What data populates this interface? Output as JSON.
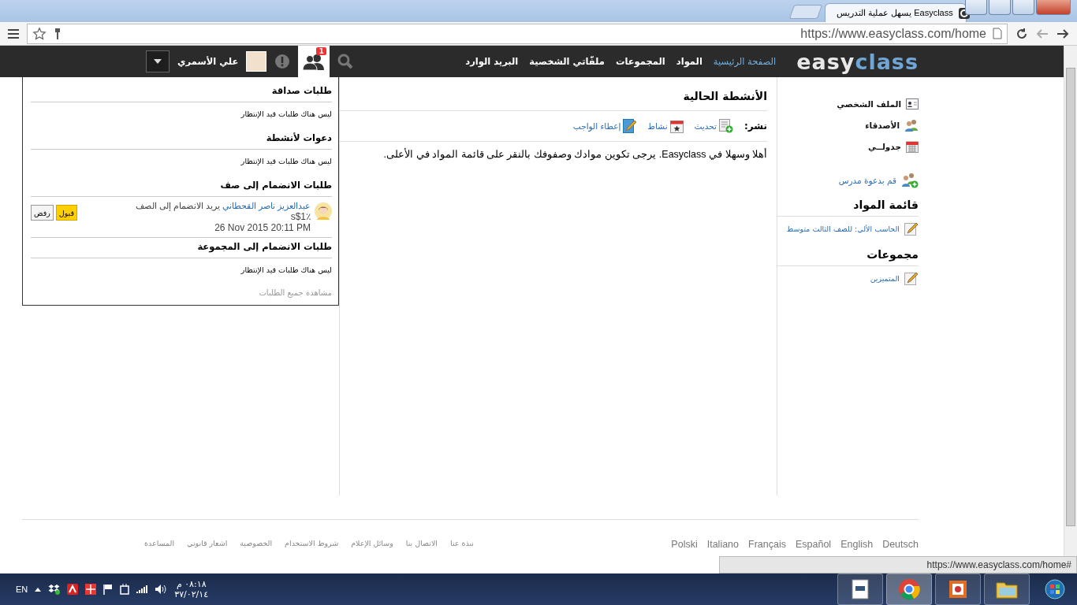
{
  "browser": {
    "tab_title": "يسهل عملية التدريس Easyclass",
    "url": "https://www.easyclass.com/home",
    "status_url": "https://www.easyclass.com/home#"
  },
  "navbar": {
    "logo": {
      "light_part": "easy",
      "blue_part": "class"
    },
    "items": [
      {
        "label": "الصفحة الرئيسية",
        "selected": true
      },
      {
        "label": "المواد",
        "selected": false
      },
      {
        "label": "المجموعات",
        "selected": false
      },
      {
        "label": "ملفّاتي الشخصية",
        "selected": false
      },
      {
        "label": "البريد الوارد",
        "selected": false
      }
    ],
    "friends_badge": "1",
    "user_name": "علي الأسمري"
  },
  "sidebar": {
    "links": [
      {
        "kind": "profile",
        "label": "الملف الشخصي"
      },
      {
        "kind": "friends",
        "label": "الأصدقاء"
      },
      {
        "kind": "calendar",
        "label": "جدولــي"
      }
    ],
    "invite": "قم بدعوة مدرس",
    "courses_title": "قائمة المواد",
    "courses": [
      "الحاسب الألي: للصف الثالث متوسط"
    ],
    "groups_title": "مجموعات",
    "groups": [
      "المتميزين"
    ]
  },
  "activity": {
    "title": "الأنشطة الحالية",
    "post_label": "نشر:",
    "post_actions": [
      {
        "kind": "update",
        "label": "تحديث"
      },
      {
        "kind": "event",
        "label": "نشاط"
      },
      {
        "kind": "assignment",
        "label": "إعطاء الواجب"
      }
    ],
    "welcome": "أهلا وسهلا في Easyclass. يرجى تكوين موادك وصفوفك بالنقر على قائمة المواد في الأعلى."
  },
  "requests": {
    "sections": [
      {
        "title": "طلبات صداقة",
        "kind": "empty",
        "text": "ليس هناك طلبات قيد الإنتظار"
      },
      {
        "title": "دعوات لأنشطة",
        "kind": "empty",
        "text": "ليس هناك طلبات قيد الإنتظار"
      },
      {
        "title": "طلبات الانضمام إلى صف",
        "kind": "request",
        "name": "عبدالعزيز ناصر القحطاني",
        "text": "يريد الانضمام إلى الصف",
        "extra": "s$1٪",
        "date": "26 Nov 2015 20:11 PM",
        "accept": "قبول",
        "reject": "رفض"
      },
      {
        "title": "طلبات الانضمام إلى المجموعة",
        "kind": "empty",
        "text": "ليس هناك طلبات قيد الإنتظار"
      }
    ],
    "view_all": "مشاهدة جميع الطلبات"
  },
  "footer": {
    "links": [
      "نبذة عنا",
      "الاتصال بنا",
      "وسائل الإعلام",
      "شروط الاستخدام",
      "الخصوصية",
      "اشعار قانوني",
      "المساعدة"
    ],
    "languages": [
      "Deutsch",
      "English",
      "Español",
      "Français",
      "Italiano",
      "Polski"
    ]
  },
  "taskbar": {
    "language": "EN",
    "time": "٠٨:١٨ م",
    "date": "٣٧/٠٢/١٤"
  }
}
